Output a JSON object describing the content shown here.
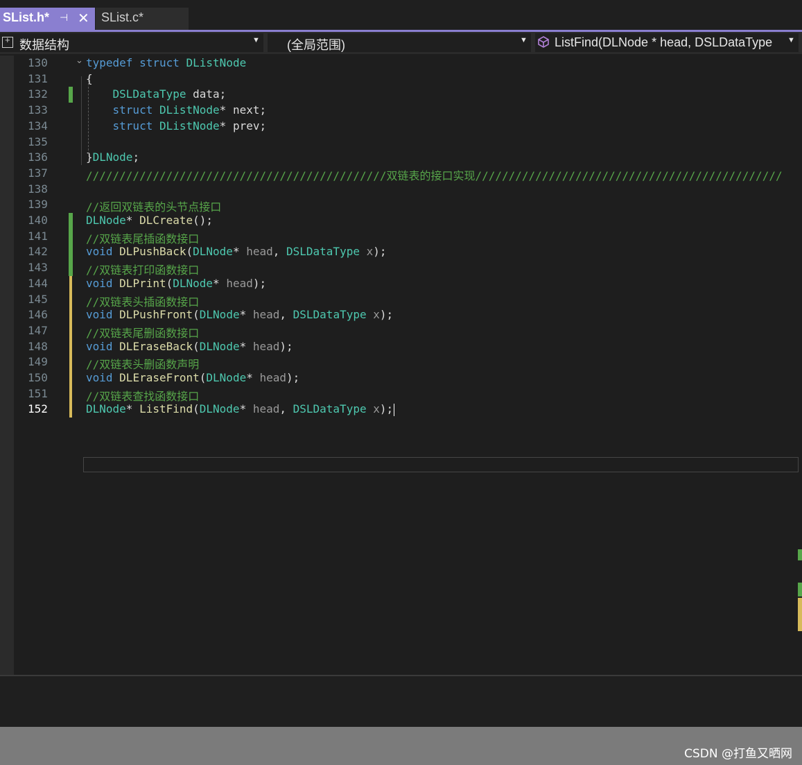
{
  "tabs": [
    {
      "label": "SList.h*",
      "active": true
    },
    {
      "label": "SList.c*",
      "active": false
    }
  ],
  "nav": {
    "project": "数据结构",
    "scope": "(全局范围)",
    "member": "ListFind(DLNode * head, DSLDataType"
  },
  "code_lines": [
    {
      "n": "130",
      "tokens": [
        [
          "kw",
          "typedef"
        ],
        [
          "pu",
          " "
        ],
        [
          "kw",
          "struct"
        ],
        [
          "pu",
          " "
        ],
        [
          "ty",
          "DListNode"
        ]
      ]
    },
    {
      "n": "131",
      "tokens": [
        [
          "pu",
          "{"
        ]
      ]
    },
    {
      "n": "132",
      "tokens": [
        [
          "pu",
          "    "
        ],
        [
          "ty",
          "DSLDataType"
        ],
        [
          "pu",
          " "
        ],
        [
          "fld",
          "data"
        ],
        [
          "pu",
          ";"
        ]
      ]
    },
    {
      "n": "133",
      "tokens": [
        [
          "pu",
          "    "
        ],
        [
          "kw",
          "struct"
        ],
        [
          "pu",
          " "
        ],
        [
          "ty",
          "DListNode"
        ],
        [
          "pu",
          "* "
        ],
        [
          "fld",
          "next"
        ],
        [
          "pu",
          ";"
        ]
      ]
    },
    {
      "n": "134",
      "tokens": [
        [
          "pu",
          "    "
        ],
        [
          "kw",
          "struct"
        ],
        [
          "pu",
          " "
        ],
        [
          "ty",
          "DListNode"
        ],
        [
          "pu",
          "* "
        ],
        [
          "fld",
          "prev"
        ],
        [
          "pu",
          ";"
        ]
      ]
    },
    {
      "n": "135",
      "tokens": []
    },
    {
      "n": "136",
      "tokens": [
        [
          "pu",
          "}"
        ],
        [
          "ty",
          "DLNode"
        ],
        [
          "pu",
          ";"
        ]
      ]
    },
    {
      "n": "137",
      "tokens": [
        [
          "cm",
          "/////////////////////////////////////////////双链表的接口实现//////////////////////////////////////////////"
        ]
      ]
    },
    {
      "n": "138",
      "tokens": []
    },
    {
      "n": "139",
      "tokens": [
        [
          "cm",
          "//返回双链表的头节点接口"
        ]
      ]
    },
    {
      "n": "140",
      "tokens": [
        [
          "ty",
          "DLNode"
        ],
        [
          "pu",
          "* "
        ],
        [
          "fn",
          "DLCreate"
        ],
        [
          "pu",
          "();"
        ]
      ]
    },
    {
      "n": "141",
      "tokens": [
        [
          "cm",
          "//双链表尾插函数接口"
        ]
      ]
    },
    {
      "n": "142",
      "tokens": [
        [
          "kw",
          "void"
        ],
        [
          "pu",
          " "
        ],
        [
          "fn",
          "DLPushBack"
        ],
        [
          "pu",
          "("
        ],
        [
          "ty",
          "DLNode"
        ],
        [
          "pu",
          "* "
        ],
        [
          "pm",
          "head"
        ],
        [
          "pu",
          ", "
        ],
        [
          "ty",
          "DSLDataType"
        ],
        [
          "pu",
          " "
        ],
        [
          "pm",
          "x"
        ],
        [
          "pu",
          ");"
        ]
      ]
    },
    {
      "n": "143",
      "tokens": [
        [
          "cm",
          "//双链表打印函数接口"
        ]
      ]
    },
    {
      "n": "144",
      "tokens": [
        [
          "kw",
          "void"
        ],
        [
          "pu",
          " "
        ],
        [
          "fn",
          "DLPrint"
        ],
        [
          "pu",
          "("
        ],
        [
          "ty",
          "DLNode"
        ],
        [
          "pu",
          "* "
        ],
        [
          "pm",
          "head"
        ],
        [
          "pu",
          ");"
        ]
      ]
    },
    {
      "n": "145",
      "tokens": [
        [
          "cm",
          "//双链表头插函数接口"
        ]
      ]
    },
    {
      "n": "146",
      "tokens": [
        [
          "kw",
          "void"
        ],
        [
          "pu",
          " "
        ],
        [
          "fn",
          "DLPushFront"
        ],
        [
          "pu",
          "("
        ],
        [
          "ty",
          "DLNode"
        ],
        [
          "pu",
          "* "
        ],
        [
          "pm",
          "head"
        ],
        [
          "pu",
          ", "
        ],
        [
          "ty",
          "DSLDataType"
        ],
        [
          "pu",
          " "
        ],
        [
          "pm",
          "x"
        ],
        [
          "pu",
          ");"
        ]
      ]
    },
    {
      "n": "147",
      "tokens": [
        [
          "cm",
          "//双链表尾删函数接口"
        ]
      ]
    },
    {
      "n": "148",
      "tokens": [
        [
          "kw",
          "void"
        ],
        [
          "pu",
          " "
        ],
        [
          "fn",
          "DLEraseBack"
        ],
        [
          "pu",
          "("
        ],
        [
          "ty",
          "DLNode"
        ],
        [
          "pu",
          "* "
        ],
        [
          "pm",
          "head"
        ],
        [
          "pu",
          ");"
        ]
      ]
    },
    {
      "n": "149",
      "tokens": [
        [
          "cm",
          "//双链表头删函数声明"
        ]
      ]
    },
    {
      "n": "150",
      "tokens": [
        [
          "kw",
          "void"
        ],
        [
          "pu",
          " "
        ],
        [
          "fn",
          "DLEraseFront"
        ],
        [
          "pu",
          "("
        ],
        [
          "ty",
          "DLNode"
        ],
        [
          "pu",
          "* "
        ],
        [
          "pm",
          "head"
        ],
        [
          "pu",
          ");"
        ]
      ]
    },
    {
      "n": "151",
      "tokens": [
        [
          "cm",
          "//双链表查找函数接口"
        ]
      ]
    },
    {
      "n": "152",
      "tokens": [
        [
          "ty",
          "DLNode"
        ],
        [
          "pu",
          "* "
        ],
        [
          "fn",
          "ListFind"
        ],
        [
          "pu",
          "("
        ],
        [
          "ty",
          "DLNode"
        ],
        [
          "pu",
          "* "
        ],
        [
          "pm",
          "head"
        ],
        [
          "pu",
          ", "
        ],
        [
          "ty",
          "DSLDataType"
        ],
        [
          "pu",
          " "
        ],
        [
          "pm",
          "x"
        ],
        [
          "pu",
          ");"
        ]
      ]
    }
  ],
  "current_line": "152",
  "saved_change_lines": [
    "132",
    "140",
    "141",
    "142",
    "143"
  ],
  "unsaved_change_lines": [
    "144",
    "145",
    "146",
    "147",
    "148",
    "149",
    "150",
    "151",
    "152"
  ],
  "colors": {
    "keyword": "#569cd6",
    "type": "#4ec9b0",
    "function": "#dcdcaa",
    "comment": "#57a64a",
    "accent": "#8a7fd0"
  },
  "watermark": "CSDN @打鱼又晒网"
}
